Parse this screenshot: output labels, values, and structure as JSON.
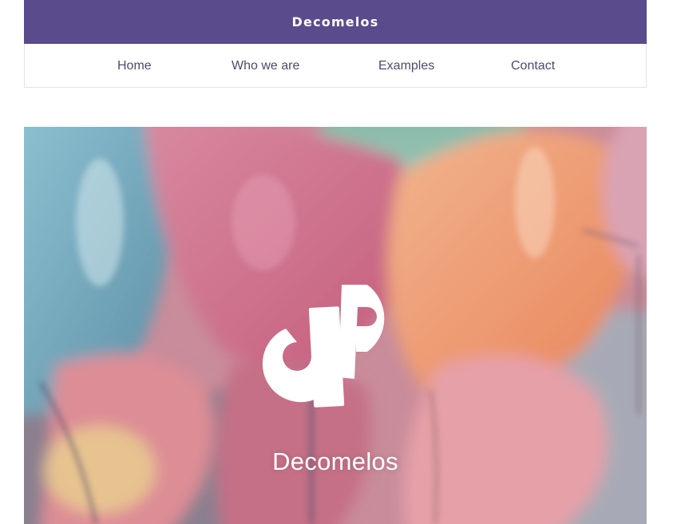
{
  "header": {
    "brand": "Decomelos",
    "bar_color": "#5a4b8c"
  },
  "nav": {
    "items": [
      {
        "label": "Home"
      },
      {
        "label": "Who we are"
      },
      {
        "label": "Examples"
      },
      {
        "label": "Contact"
      }
    ],
    "text_color": "#4f4a6e"
  },
  "hero": {
    "title": "Decomelos",
    "logo_icon": "dp-logo-icon",
    "background": "pastel-balloons-photo"
  }
}
